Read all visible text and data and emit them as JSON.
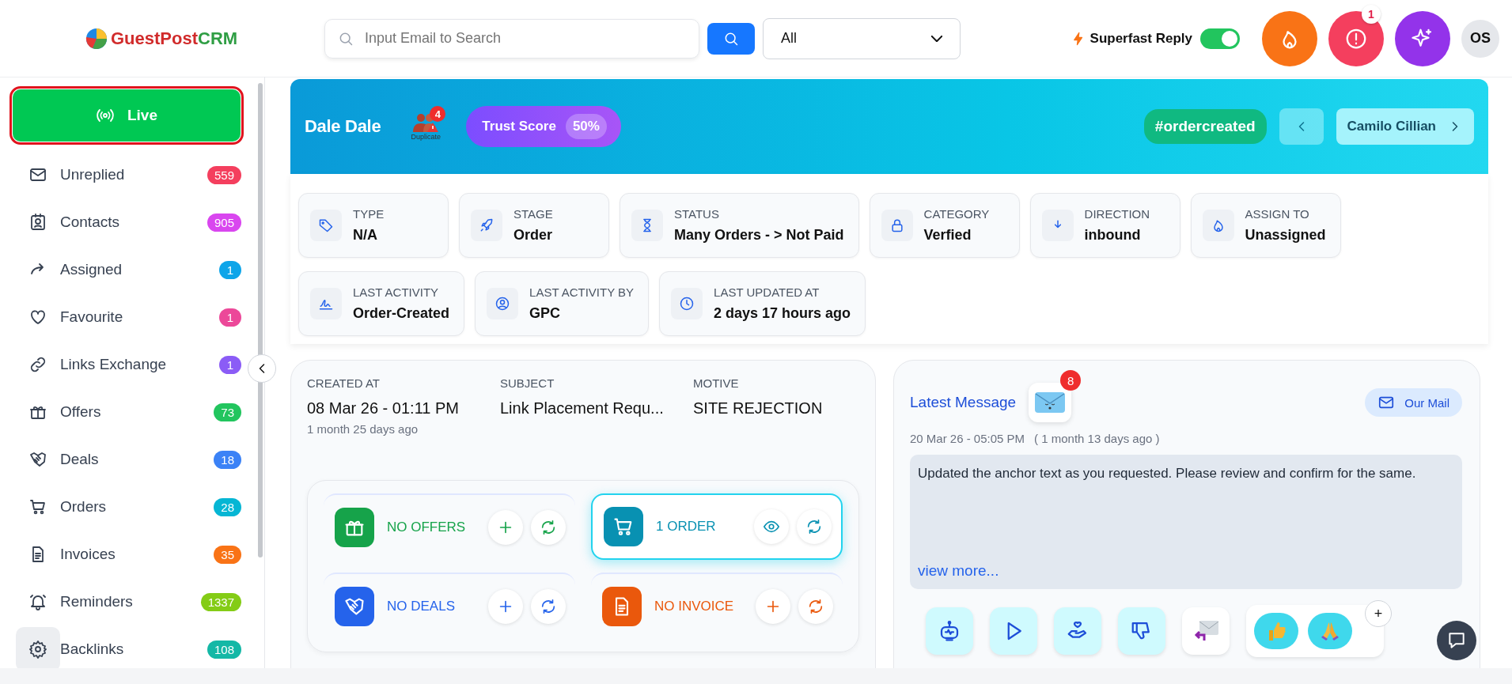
{
  "header": {
    "logo": {
      "brand": "GuestPost",
      "suffix": "CRM"
    },
    "search": {
      "placeholder": "Input Email to Search"
    },
    "filter": {
      "value": "All"
    },
    "superfast_reply": {
      "label": "Superfast Reply",
      "on": true
    },
    "alerts_badge": "1",
    "avatar": "OS"
  },
  "sidebar": {
    "live": {
      "label": "Live",
      "selected": true
    },
    "items": [
      {
        "label": "Unreplied",
        "count": "559",
        "color": "#f43f5e"
      },
      {
        "label": "Contacts",
        "count": "905",
        "color": "#d946ef"
      },
      {
        "label": "Assigned",
        "count": "1",
        "color": "#0ea5e9"
      },
      {
        "label": "Favourite",
        "count": "1",
        "color": "#ec4899"
      },
      {
        "label": "Links Exchange",
        "count": "1",
        "color": "#8b5cf6"
      },
      {
        "label": "Offers",
        "count": "73",
        "color": "#22c55e"
      },
      {
        "label": "Deals",
        "count": "18",
        "color": "#3b82f6"
      },
      {
        "label": "Orders",
        "count": "28",
        "color": "#06b6d4"
      },
      {
        "label": "Invoices",
        "count": "35",
        "color": "#f97316"
      },
      {
        "label": "Reminders",
        "count": "1337",
        "color": "#84cc16"
      },
      {
        "label": "Backlinks",
        "count": "108",
        "color": "#14b8a6"
      }
    ]
  },
  "contact": {
    "name": "Dale Dale",
    "duplicate": {
      "label": "Duplicate",
      "count": "4"
    },
    "trust_score": {
      "label": "Trust Score",
      "value": "50%"
    },
    "tag": "#ordercreated",
    "next_contact": "Camilo Cillian"
  },
  "info_cards": [
    {
      "label": "TYPE",
      "value": "N/A"
    },
    {
      "label": "STAGE",
      "value": "Order"
    },
    {
      "label": "STATUS",
      "value": "Many Orders - > Not Paid"
    },
    {
      "label": "CATEGORY",
      "value": "Verfied"
    },
    {
      "label": "DIRECTION",
      "value": "inbound"
    },
    {
      "label": "ASSIGN TO",
      "value": "Unassigned"
    },
    {
      "label": "LAST ACTIVITY",
      "value": "Order-Created"
    },
    {
      "label": "LAST ACTIVITY BY",
      "value": "GPC"
    },
    {
      "label": "LAST UPDATED AT",
      "value": "2 days 17 hours ago"
    }
  ],
  "overview": {
    "fields": [
      {
        "label": "CREATED AT",
        "value": "08 Mar 26 - 01:11 PM",
        "note": "1 month 25 days ago"
      },
      {
        "label": "SUBJECT",
        "value": "Link Placement Requ..."
      },
      {
        "label": "MOTIVE",
        "value": "SITE REJECTION"
      }
    ],
    "tiles": [
      {
        "label": "NO OFFERS",
        "color": "#16a34a",
        "kind": "add",
        "selected": false
      },
      {
        "label": "1 ORDER",
        "color": "#0891b2",
        "kind": "view",
        "selected": true
      },
      {
        "label": "NO DEALS",
        "color": "#2563eb",
        "kind": "add",
        "selected": false
      },
      {
        "label": "NO INVOICE",
        "color": "#ea580c",
        "kind": "add",
        "selected": false
      }
    ]
  },
  "latest_message": {
    "title": "Latest Message",
    "unread": "8",
    "mailbox": "Our Mail",
    "date": "20 Mar 26 - 05:05 PM",
    "ago": "( 1 month 13 days ago )",
    "body": "Updated the anchor text as you requested. Please review and confirm for the same.",
    "more": "view more...",
    "add_reaction": "+"
  }
}
